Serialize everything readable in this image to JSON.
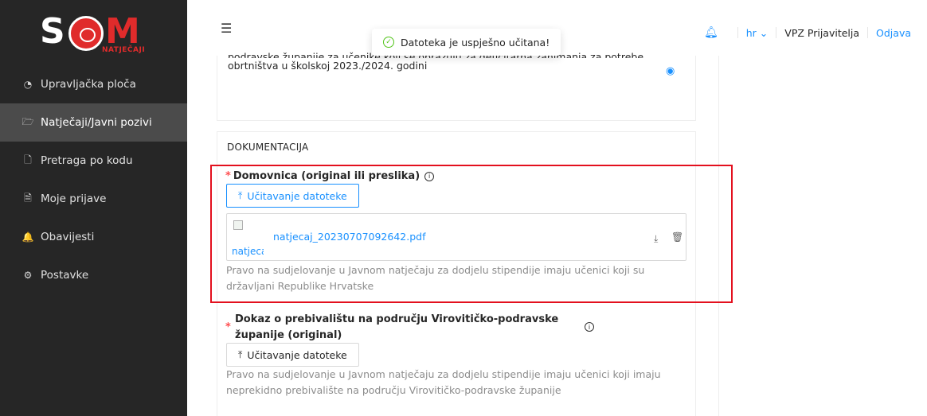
{
  "logo": {
    "s": "S",
    "m": "M",
    "sub": "NATJEČAJI"
  },
  "sidebar": {
    "items": [
      {
        "label": "Upravljačka ploča",
        "icon": "dashboard-icon",
        "glyph": "◔",
        "active": false
      },
      {
        "label": "Natječaji/Javni pozivi",
        "icon": "folder-open-icon",
        "glyph": "🗁",
        "active": true
      },
      {
        "label": "Pretraga po kodu",
        "icon": "file-search-icon",
        "glyph": "🗋",
        "active": false
      },
      {
        "label": "Moje prijave",
        "icon": "file-text-icon",
        "glyph": "🗎",
        "active": false
      },
      {
        "label": "Obavijesti",
        "icon": "bell-icon",
        "glyph": "🔔",
        "active": false
      },
      {
        "label": "Postavke",
        "icon": "settings-icon",
        "glyph": "⚙",
        "active": false
      }
    ]
  },
  "toast": {
    "message": "Datoteka je uspješno učitana!"
  },
  "header": {
    "lang": "hr",
    "user": "VPZ Prijavitelja",
    "logout": "Odjava"
  },
  "competition": {
    "description_cut": "podravske županije za učenike koji se obrazuju za deficitarna zanimanja za potrebe",
    "description": "obrtništva u školskoj 2023./2024. godini"
  },
  "documentation": {
    "title": "DOKUMENTACIJA",
    "fields": [
      {
        "label": "Domovnica (original ili preslika)",
        "upload_label": "Učitavanje datoteke",
        "file": {
          "name": "natjecaj_20230707092642.pdf",
          "thumb_alt": "natjecaj"
        },
        "help": "Pravo na sudjelovanje u Javnom natječaju za dodjelu stipendije imaju učenici koji su državljani Republike Hrvatske"
      },
      {
        "label": "Dokaz o prebivalištu na području Virovitičko-podravske županije (original)",
        "upload_label": "Učitavanje datoteke",
        "help": "Pravo na sudjelovanje u Javnom natječaju za dodjelu stipendije imaju učenici koji imaju neprekidno prebivalište na području Virovitičko-podravske županije"
      }
    ]
  },
  "colors": {
    "sidebar": "#262626",
    "active": "#4b4b4b",
    "accent": "#1890ff",
    "brand": "#e02b2b",
    "highlight": "#e3101e"
  }
}
